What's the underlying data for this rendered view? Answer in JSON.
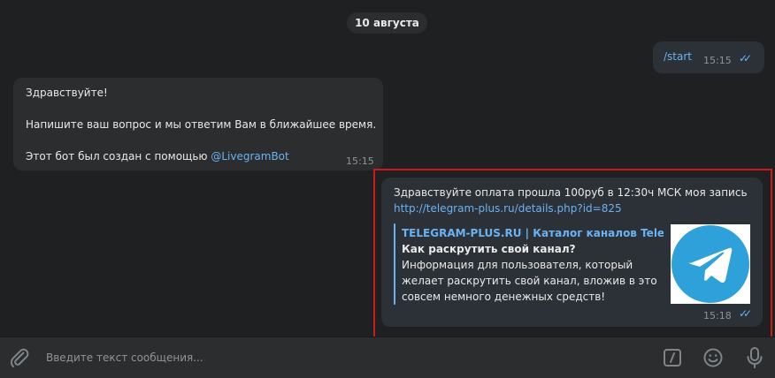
{
  "date_separator": "10 августа",
  "messages": {
    "start": {
      "text": "/start",
      "time": "15:15",
      "status": "read"
    },
    "bot": {
      "greeting": "Здравствуйте!",
      "line2": "Напишите ваш вопрос и мы ответим Вам в ближайшее время.",
      "line3_prefix": "Этот бот был создан с помощью ",
      "line3_link": "@LivegramBot",
      "time": "15:15"
    },
    "payment": {
      "text": "Здравствуйте оплата прошла 100руб в 12:30ч  МСК моя запись",
      "link": "http://telegram-plus.ru/details.php?id=825",
      "preview": {
        "site": "TELEGRAM-PLUS.RU | Каталог каналов Telegram",
        "title": "Как раскрутить свой канал?",
        "desc1": "Информация для пользователя, который",
        "desc2": "желает раскрутить свой канал, вложив в это",
        "desc3": "совсем немного денежных средств!",
        "thumb_icon": "telegram-logo-icon"
      },
      "time": "15:18",
      "status": "read"
    }
  },
  "composer": {
    "placeholder": "Введите текст сообщения...",
    "attach_icon": "paperclip-icon",
    "commands_icon": "bot-commands-icon",
    "emoji_icon": "emoji-icon",
    "mic_icon": "microphone-icon"
  },
  "colors": {
    "background": "#1e2021",
    "bubble": "#2b2d2f",
    "accent": "#6ab3f3",
    "highlight_border": "#cc1b1b"
  }
}
